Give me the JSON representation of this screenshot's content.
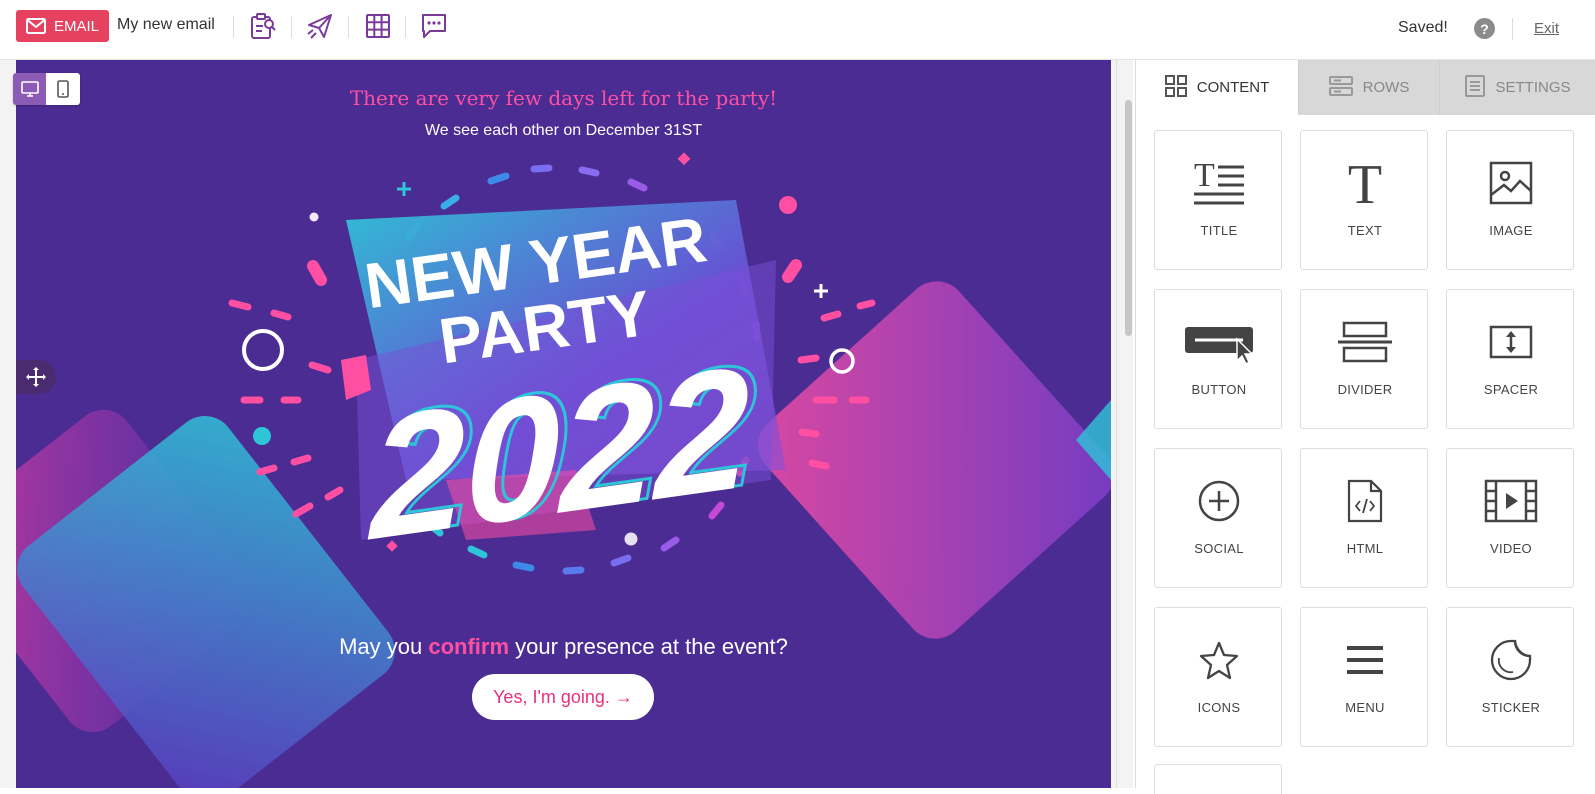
{
  "topbar": {
    "badge_label": "EMAIL",
    "email_name": "My new email",
    "tools": [
      "clipboard-search-icon",
      "send-icon",
      "grid-icon",
      "chat-icon"
    ],
    "status": "Saved!",
    "help": "?",
    "exit": "Exit"
  },
  "canvas": {
    "headline": "There are very few days left for the party!",
    "subline": "We see each other on December 31ST",
    "art": {
      "line1": "NEW YEAR",
      "line2": "PARTY",
      "year": "2022"
    },
    "confirm_pre": "May you ",
    "confirm_hl": "confirm",
    "confirm_post": " your presence at the event?",
    "cta": "Yes, I'm going. →"
  },
  "panel": {
    "tabs": [
      {
        "label": "CONTENT",
        "icon": "blocks-icon",
        "active": true
      },
      {
        "label": "ROWS",
        "icon": "rows-icon",
        "active": false
      },
      {
        "label": "SETTINGS",
        "icon": "settings-list-icon",
        "active": false
      }
    ],
    "tiles": [
      {
        "label": "TITLE",
        "icon": "title-icon"
      },
      {
        "label": "TEXT",
        "icon": "text-icon"
      },
      {
        "label": "IMAGE",
        "icon": "image-icon"
      },
      {
        "label": "BUTTON",
        "icon": "button-icon"
      },
      {
        "label": "DIVIDER",
        "icon": "divider-icon"
      },
      {
        "label": "SPACER",
        "icon": "spacer-icon"
      },
      {
        "label": "SOCIAL",
        "icon": "social-icon"
      },
      {
        "label": "HTML",
        "icon": "html-icon"
      },
      {
        "label": "VIDEO",
        "icon": "video-icon"
      },
      {
        "label": "ICONS",
        "icon": "star-icon"
      },
      {
        "label": "MENU",
        "icon": "menu-icon"
      },
      {
        "label": "STICKER",
        "icon": "sticker-icon"
      }
    ]
  },
  "colors": {
    "accent": "#e6415f",
    "canvas_bg": "#4b2c93",
    "pink": "#ff4fa3",
    "cyan": "#2ec5d8",
    "tool_purple": "#7a3a9a"
  }
}
